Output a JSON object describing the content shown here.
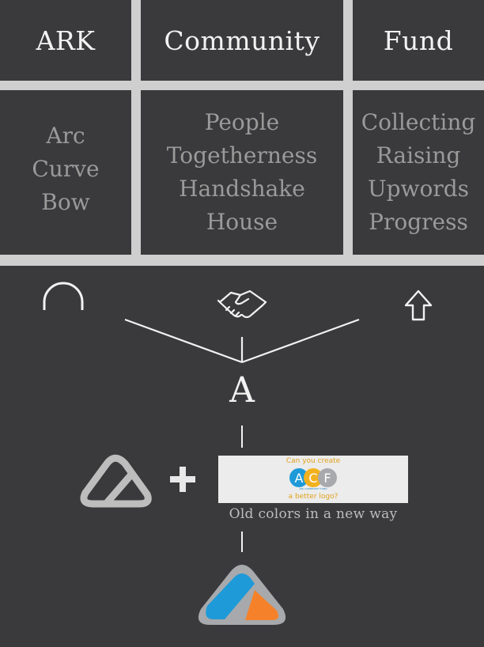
{
  "columns": [
    {
      "heading": "ARK",
      "words": [
        "Arc",
        "Curve",
        "Bow"
      ]
    },
    {
      "heading": "Community",
      "words": [
        "People",
        "Togetherness",
        "Handshake",
        "House"
      ]
    },
    {
      "heading": "Fund",
      "words": [
        "Collecting",
        "Raising",
        "Upwords",
        "Progress"
      ]
    }
  ],
  "icons": {
    "ark": "arc-icon",
    "community": "handshake-icon",
    "fund": "arrow-up-icon"
  },
  "merge_letter": "A",
  "old_logo": {
    "top_text": "Can you create",
    "letters": [
      "A",
      "C",
      "F"
    ],
    "tiny_text": "ARC COMMUNITY FUND",
    "bottom_text": "a better logo?"
  },
  "old_logo_caption": "Old colors in a new way",
  "colors": {
    "background": "#3a3a3c",
    "grid_lines": "#cfcfcf",
    "heading_text": "#f2f2f2",
    "word_text": "#9a9a9a",
    "blue": "#1e9ad8",
    "orange": "#f5822a",
    "logo_gray": "#a7a9ac",
    "old_yellow": "#f2b11e"
  }
}
